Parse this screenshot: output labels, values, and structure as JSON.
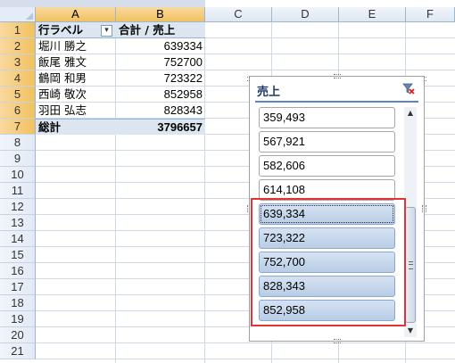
{
  "columns": [
    "A",
    "B",
    "C",
    "D",
    "E",
    "F"
  ],
  "rows": [
    "1",
    "2",
    "3",
    "4",
    "5",
    "6",
    "7",
    "8",
    "9",
    "10",
    "11",
    "12",
    "13",
    "14",
    "15",
    "16",
    "17",
    "18",
    "19",
    "20",
    "21"
  ],
  "pivot": {
    "header": {
      "row_label": "行ラベル",
      "sum_label": "合計 / 売上"
    },
    "rows": [
      {
        "name": "堀川 勝之",
        "value": "639334"
      },
      {
        "name": "飯尾 雅文",
        "value": "752700"
      },
      {
        "name": "鶴岡 和男",
        "value": "723322"
      },
      {
        "name": "西崎 敬次",
        "value": "852958"
      },
      {
        "name": "羽田 弘志",
        "value": "828343"
      }
    ],
    "total": {
      "label": "総計",
      "value": "3796657"
    }
  },
  "slicer": {
    "title": "売上",
    "items": [
      {
        "label": "359,493",
        "selected": false
      },
      {
        "label": "567,921",
        "selected": false
      },
      {
        "label": "582,606",
        "selected": false
      },
      {
        "label": "614,108",
        "selected": false
      },
      {
        "label": "639,334",
        "selected": true
      },
      {
        "label": "723,322",
        "selected": true
      },
      {
        "label": "752,700",
        "selected": true
      },
      {
        "label": "828,343",
        "selected": true
      },
      {
        "label": "852,958",
        "selected": true
      }
    ]
  },
  "colors": {
    "selected_item": "#b8cde6",
    "highlight": "#e53333",
    "header_fill": "#dce6f1"
  }
}
